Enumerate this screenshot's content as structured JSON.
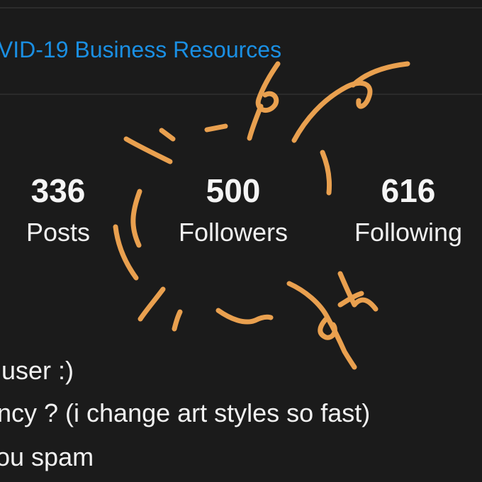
{
  "links": {
    "covid_resources": "OVID-19 Business Resources"
  },
  "stats": {
    "posts": {
      "count": "336",
      "label": "Posts"
    },
    "followers": {
      "count": "500",
      "label": "Followers"
    },
    "following": {
      "count": "616",
      "label": "Following"
    }
  },
  "bio": {
    "line1": "user :)",
    "line2": "ncy ? (i change art styles so fast)",
    "line3": "ou spam"
  },
  "colors": {
    "background": "#1b1b1b",
    "link": "#1a8fe3",
    "text": "#f2f2f2",
    "scribble": "#e9a04f"
  }
}
